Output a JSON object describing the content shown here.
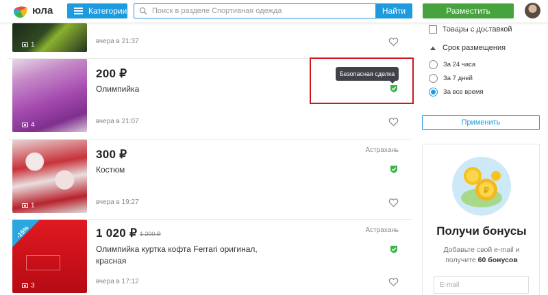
{
  "header": {
    "logo_text": "юла",
    "categories_label": "Категории",
    "search_placeholder": "Поиск в разделе Спортивная одежда",
    "find_label": "Найти",
    "post_ad_label": "Разместить объявление"
  },
  "listings": [
    {
      "price": "",
      "old_price": "",
      "title": "",
      "city": "",
      "time": "вчера в 21:37",
      "photos": "1",
      "safe_deal": false
    },
    {
      "price": "200 ₽",
      "old_price": "",
      "title": "Олимпийка",
      "city": "",
      "time": "вчера в 21:07",
      "photos": "4",
      "safe_deal": true
    },
    {
      "price": "300 ₽",
      "old_price": "",
      "title": "Костюм",
      "city": "Астрахань",
      "time": "вчера в 19:27",
      "photos": "1",
      "safe_deal": true
    },
    {
      "price": "1 020 ₽",
      "old_price": "1 200 ₽",
      "title": "Олимпийка куртка кофта Ferrari оригинал, красная",
      "city": "Астрахань",
      "time": "вчера в 17:12",
      "photos": "3",
      "safe_deal": true,
      "badge": "-15%"
    }
  ],
  "tooltip": "Безопасная сделка",
  "filters": {
    "delivery_label": "Товары с доставкой",
    "period_title": "Срок размещения",
    "options": [
      "За 24 часа",
      "За 7 дней",
      "За все время"
    ],
    "selected": 2,
    "apply_label": "Применить"
  },
  "bonus": {
    "title": "Получи бонусы",
    "text_line1": "Добавьте свой e-mail и",
    "text_line2_prefix": "получите ",
    "text_line2_bold": "60 бонусов",
    "email_placeholder": "E-mail"
  },
  "colors": {
    "accent": "#1e9adf",
    "post_button": "#47a33e",
    "safe_deal_green": "#3ab54a",
    "highlight_red": "#d0161b"
  }
}
